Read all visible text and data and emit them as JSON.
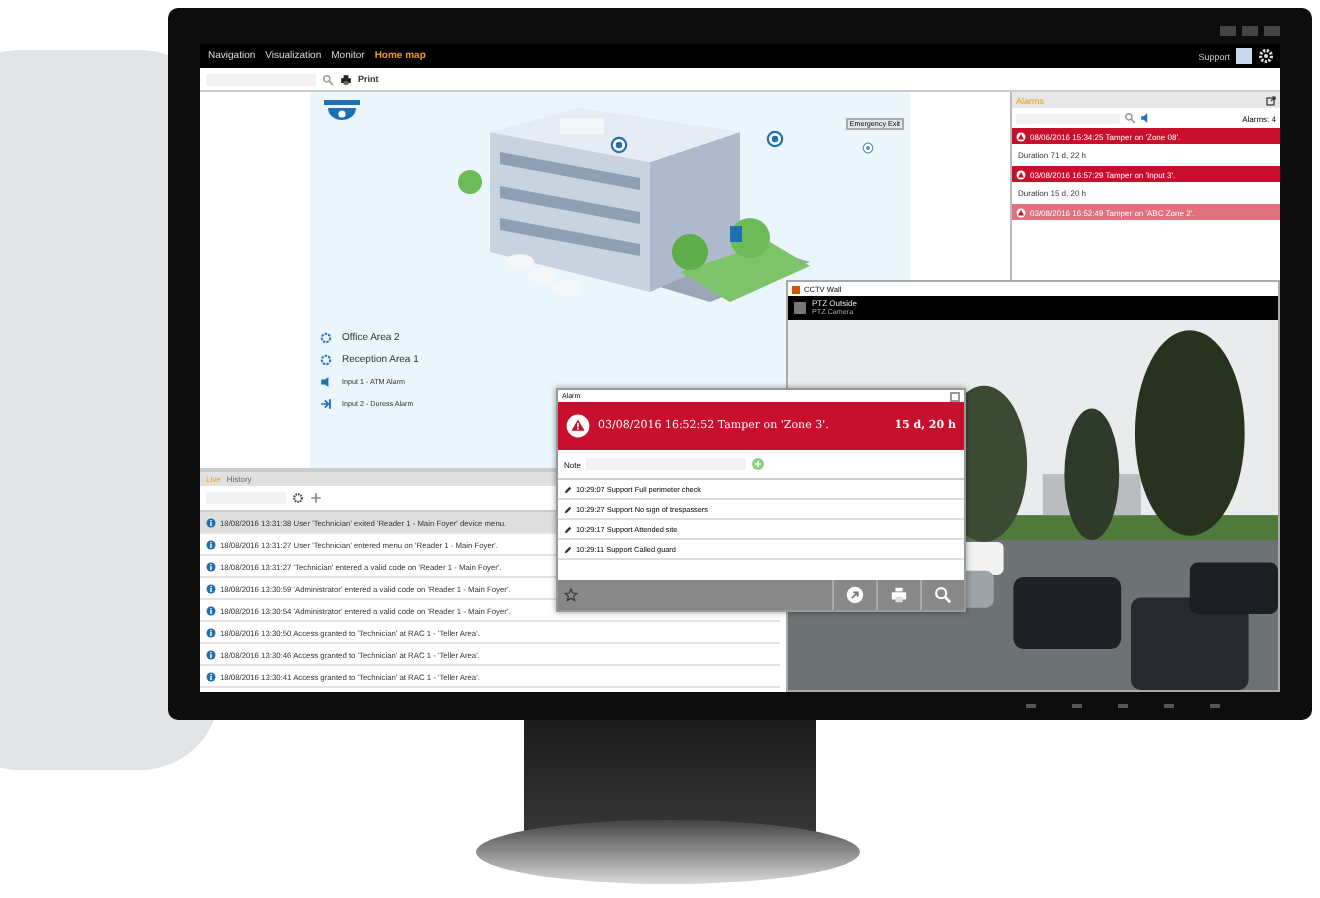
{
  "menu": [
    {
      "label": "Navigation",
      "selected": false
    },
    {
      "label": "Visualization",
      "selected": false
    },
    {
      "label": "Monitor",
      "selected": false
    },
    {
      "label": "Home map",
      "selected": true
    }
  ],
  "user": "Support",
  "toolbar": {
    "print": "Print"
  },
  "map": {
    "tag": "Emergency Exit",
    "legend": [
      {
        "label": "Office Area 2",
        "kind": "area"
      },
      {
        "label": "Reception Area 1",
        "kind": "area"
      },
      {
        "label": "Input 1 - ATM Alarm",
        "kind": "input"
      },
      {
        "label": "Input 2 - Duress Alarm",
        "kind": "output"
      }
    ]
  },
  "alarms": {
    "title": "Alarms",
    "count": "Alarms: 4",
    "items": [
      {
        "text": "08/06/2016 15:34:25 Tamper on 'Zone 08'.",
        "duration": "Duration 71 d, 22 h",
        "acknowledged": false
      },
      {
        "text": "03/08/2016 16:57:29 Tamper on 'Input 3'.",
        "duration": "Duration 15 d, 20 h",
        "acknowledged": false
      },
      {
        "text": "03/08/2016 16:52:49 Tamper on 'ABC Zone 2'.",
        "acknowledged": true
      }
    ]
  },
  "log": {
    "tabs": [
      {
        "label": "Live",
        "selected": true
      },
      {
        "label": "History",
        "selected": false
      }
    ],
    "rows": [
      {
        "time": "18/08/2016 13:31:38",
        "text": "User 'Technician' exited 'Reader 1 - Main Foyer' device menu.",
        "selected": true
      },
      {
        "time": "18/08/2016 13:31:27",
        "text": "User 'Technician' entered menu on 'Reader 1 - Main Foyer'.",
        "selected": false
      },
      {
        "time": "18/08/2016 13:31:27",
        "text": "'Technician' entered a valid code on 'Reader 1 - Main Foyer'.",
        "selected": false
      },
      {
        "time": "18/08/2016 13:30:59",
        "text": "'Administrator' entered a valid code on 'Reader 1 - Main Foyer'.",
        "selected": false
      },
      {
        "time": "18/08/2016 13:30:54",
        "text": "'Administrator' entered a valid code on 'Reader 1 - Main Foyer'.",
        "selected": false
      },
      {
        "time": "18/08/2016 13:30:50",
        "text": "Access granted to 'Technician' at RAC 1 - 'Teller Area'.",
        "selected": false
      },
      {
        "time": "18/08/2016 13:30:46",
        "text": "Access granted to 'Technician' at RAC 1 - 'Teller Area'.",
        "selected": false
      },
      {
        "time": "18/08/2016 13:30:41",
        "text": "Access granted to 'Technician' at RAC 1 - 'Teller Area'.",
        "selected": false
      }
    ]
  },
  "cctv": {
    "title": "CCTV Wall",
    "camera": "PTZ Outside",
    "camera_type": "PTZ Camera"
  },
  "popup": {
    "title": "Alarm",
    "message": "03/08/2016 16:52:52 Tamper on 'Zone 3'.",
    "age": "15 d, 20 h",
    "note_label": "Note",
    "notes": [
      "10:29:07 Support Full perimeter check",
      "10:29:27 Support No sign of trespassers",
      "10:29:17 Support Attended site",
      "10:29:11 Support Called guard"
    ]
  }
}
